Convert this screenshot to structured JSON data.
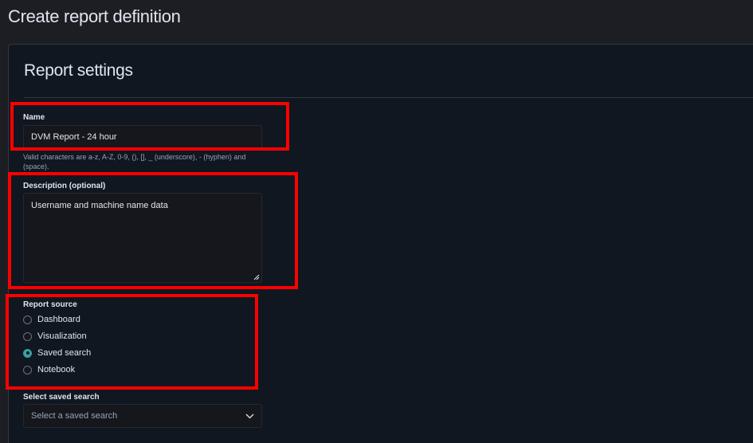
{
  "page": {
    "title": "Create report definition"
  },
  "report_settings": {
    "title": "Report settings",
    "name": {
      "label": "Name",
      "value": "DVM Report - 24 hour",
      "help": "Valid characters are a-z, A-Z, 0-9, (), [], _ (underscore), - (hyphen) and (space)."
    },
    "description": {
      "label": "Description (optional)",
      "value": "Username and machine name data"
    },
    "report_source": {
      "label": "Report source",
      "options": [
        {
          "label": "Dashboard",
          "selected": false
        },
        {
          "label": "Visualization",
          "selected": false
        },
        {
          "label": "Saved search",
          "selected": true
        },
        {
          "label": "Notebook",
          "selected": false
        }
      ]
    },
    "saved_search": {
      "label": "Select saved search",
      "placeholder": "Select a saved search"
    }
  },
  "colors": {
    "background": "#1d1e24",
    "panel": "#111721",
    "accent": "#36a2a0",
    "highlight": "#ff0000"
  },
  "icons": {
    "resize": "resize-grip-icon",
    "dropdown": "chevron-down-icon"
  }
}
